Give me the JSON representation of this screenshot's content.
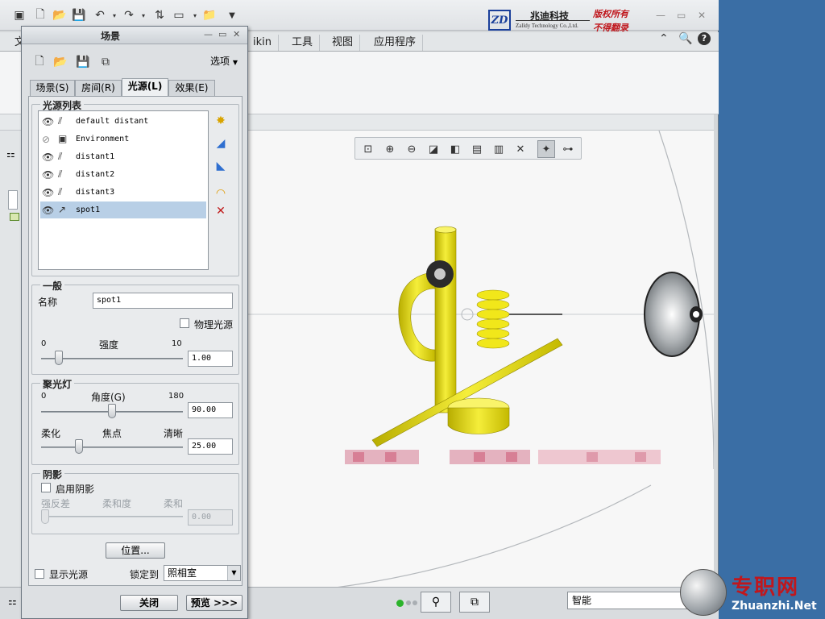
{
  "brand": {
    "cn": "兆迪科技",
    "en": "Zalldy Technology Co.,Ltd.",
    "rights1": "版权所有",
    "rights2": "不得翻录",
    "logo": "ZD"
  },
  "ribbon": {
    "tabs": [
      "文",
      "ikin",
      "工具",
      "视图",
      "应用程序"
    ]
  },
  "dialog": {
    "title": "场景",
    "options_label": "选项",
    "tabs": [
      {
        "label": "场景(S)"
      },
      {
        "label": "房间(R)"
      },
      {
        "label": "光源(L)"
      },
      {
        "label": "效果(E)"
      }
    ],
    "light_list_title": "光源列表",
    "lights": [
      {
        "name": "default distant",
        "visible": true,
        "type": "distant"
      },
      {
        "name": "Environment",
        "visible": false,
        "type": "environment"
      },
      {
        "name": "distant1",
        "visible": true,
        "type": "distant"
      },
      {
        "name": "distant2",
        "visible": true,
        "type": "distant"
      },
      {
        "name": "distant3",
        "visible": true,
        "type": "distant"
      },
      {
        "name": "spot1",
        "visible": true,
        "type": "spot",
        "selected": true
      }
    ],
    "general": {
      "title": "一般",
      "name_label": "名称",
      "name_value": "spot1",
      "physical_label": "物理光源",
      "intensity_label": "强度",
      "intensity_min": "0",
      "intensity_max": "10",
      "intensity_value": "1.00",
      "intensity_fraction": 0.1
    },
    "spotlight": {
      "title": "聚光灯",
      "angle_label": "角度(G)",
      "angle_min": "0",
      "angle_max": "180",
      "angle_value": "90.00",
      "angle_fraction": 0.5,
      "soft_label": "柔化",
      "focus_label": "焦点",
      "sharp_label": "清晰",
      "focus_value": "25.00",
      "focus_fraction": 0.25
    },
    "shadow": {
      "title": "阴影",
      "enable_label": "启用阴影",
      "contrast_label": "强反差",
      "softness_label": "柔和度",
      "soft_label": "柔和",
      "softness_value": "0.00"
    },
    "position_button": "位置...",
    "show_lights_label": "显示光源",
    "lock_label": "锁定到",
    "lock_value": "照相室",
    "close_button": "关闭",
    "preview_button": "预览 >>>"
  },
  "status": {
    "filter_value": "智能"
  },
  "watermark": {
    "cn": "专职网",
    "en": "Zhuanzhi.Net"
  },
  "colors": {
    "model_yellow": "#e8e000",
    "selection_blue": "#b8cfe6",
    "brand_red": "#c0171d",
    "brand_blue": "#1a3f9a"
  }
}
